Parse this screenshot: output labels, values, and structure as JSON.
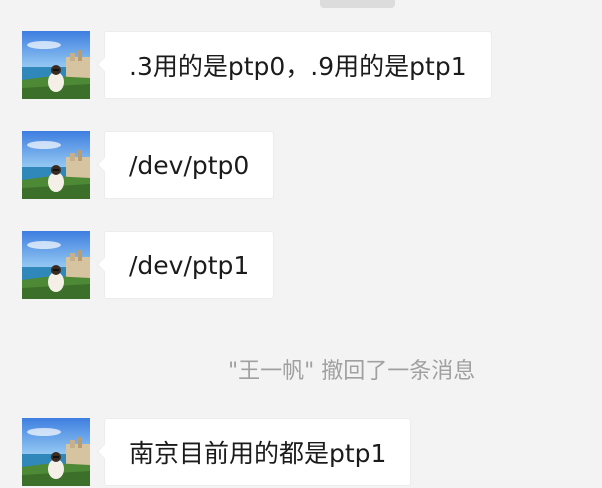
{
  "messages": [
    {
      "avatar": "beach-portrait-avatar",
      "text": ".3用的是ptp0，.9用的是ptp1"
    },
    {
      "avatar": "beach-portrait-avatar",
      "text": "/dev/ptp0"
    },
    {
      "avatar": "beach-portrait-avatar",
      "text": "/dev/ptp1"
    },
    {
      "avatar": "beach-portrait-avatar",
      "text": "南京目前用的都是ptp1"
    }
  ],
  "system_notice": {
    "text": "\"王一帆\" 撤回了一条消息"
  },
  "colors": {
    "background": "#f3f3f3",
    "bubble": "#ffffff",
    "message_text": "#1b1b1b",
    "notice_text": "#a0a0a0"
  }
}
